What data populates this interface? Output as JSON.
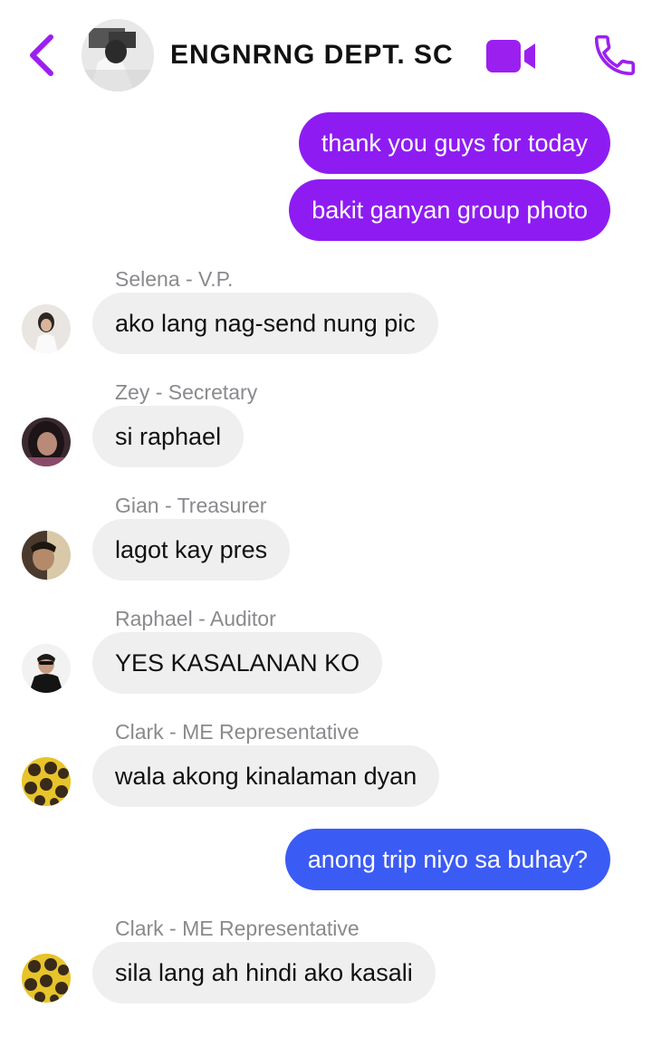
{
  "header": {
    "title": "ENGNRNG DEPT. SC",
    "back_icon": "chevron-left-icon",
    "video_icon": "video-camera-icon",
    "call_icon": "phone-icon",
    "accent": "#9b20f0"
  },
  "messages": [
    {
      "direction": "outgoing",
      "text": "thank you guys for today"
    },
    {
      "direction": "outgoing",
      "text": "bakit ganyan group photo"
    },
    {
      "direction": "incoming",
      "sender": "Selena - V.P.",
      "text": "ako lang nag-send nung pic"
    },
    {
      "direction": "incoming",
      "sender": "Zey - Secretary",
      "text": "si raphael"
    },
    {
      "direction": "incoming",
      "sender": "Gian - Treasurer",
      "text": "lagot kay pres"
    },
    {
      "direction": "incoming",
      "sender": "Raphael - Auditor",
      "text": "YES KASALANAN KO"
    },
    {
      "direction": "incoming",
      "sender": "Clark - ME Representative",
      "text": "wala akong kinalaman dyan"
    },
    {
      "direction": "outgoing",
      "text": "anong trip niyo sa buhay?"
    },
    {
      "direction": "incoming",
      "sender": "Clark - ME Representative",
      "text": "sila lang ah hindi ako kasali"
    }
  ],
  "colors": {
    "outgoing_purple": "#8e1cf2",
    "outgoing_blue": "#3b5bf5",
    "incoming_bg": "#efefef",
    "sender_text": "#8a8a8e"
  }
}
